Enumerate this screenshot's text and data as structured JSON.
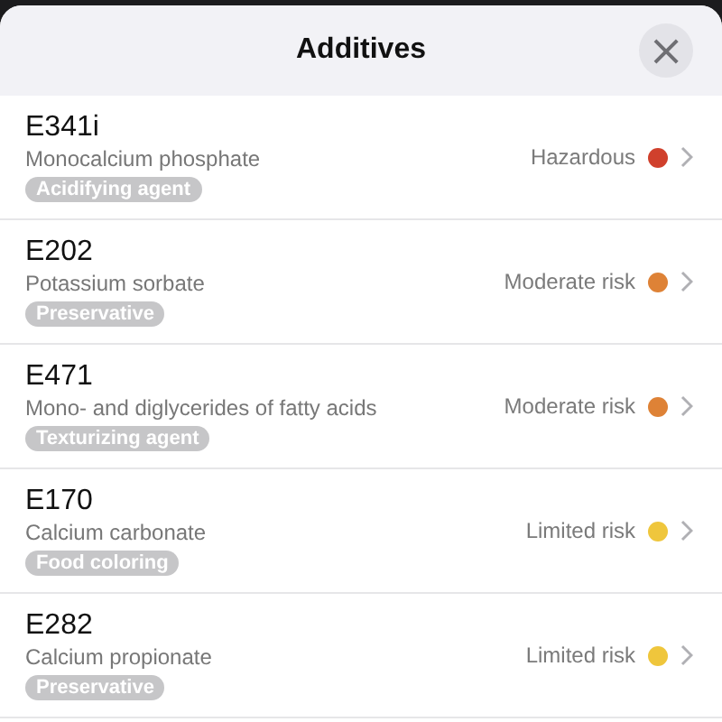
{
  "header": {
    "title": "Additives",
    "close_label": "×"
  },
  "additives": [
    {
      "code": "E341i",
      "name": "Monocalcium phosphate",
      "tag": "Acidifying agent",
      "risk": "Hazardous",
      "color": "#d0402c"
    },
    {
      "code": "E202",
      "name": "Potassium sorbate",
      "tag": "Preservative",
      "risk": "Moderate risk",
      "color": "#de8236"
    },
    {
      "code": "E471",
      "name": "Mono- and diglycerides of fatty acids",
      "tag": "Texturizing agent",
      "risk": "Moderate risk",
      "color": "#de8236"
    },
    {
      "code": "E170",
      "name": "Calcium carbonate",
      "tag": "Food coloring",
      "risk": "Limited risk",
      "color": "#efc63c"
    },
    {
      "code": "E282",
      "name": "Calcium propionate",
      "tag": "Preservative",
      "risk": "Limited risk",
      "color": "#efc63c"
    }
  ]
}
